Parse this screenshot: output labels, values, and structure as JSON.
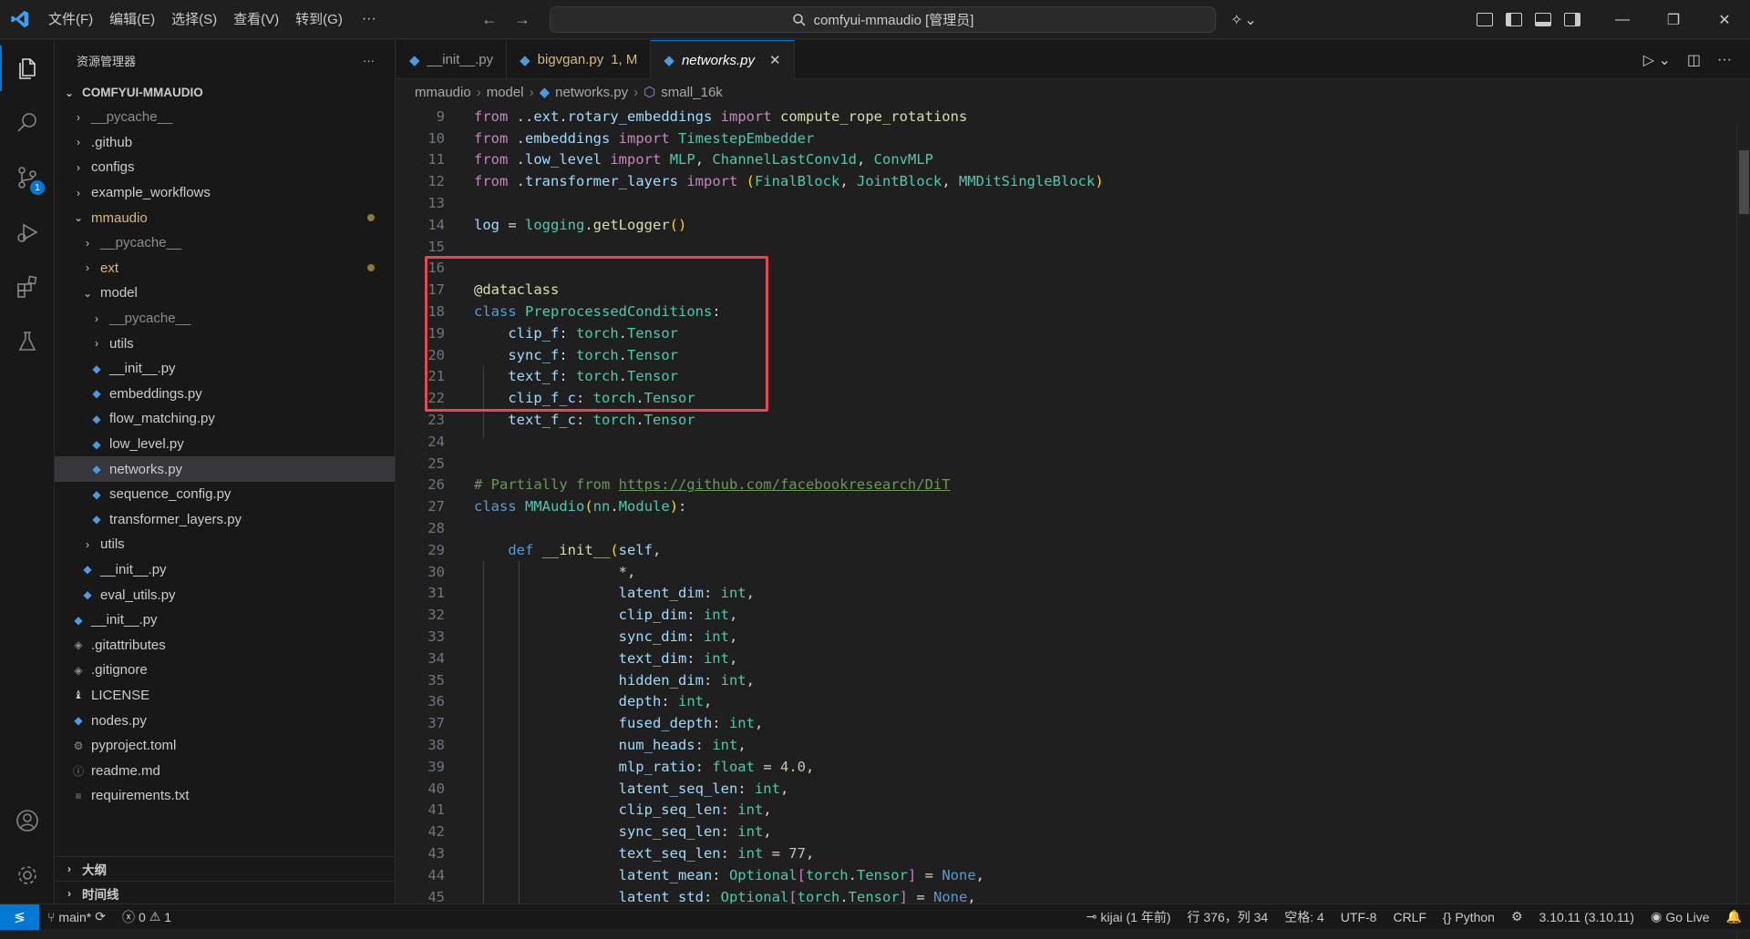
{
  "titlebar": {
    "menus": [
      "文件(F)",
      "编辑(E)",
      "选择(S)",
      "查看(V)",
      "转到(G)"
    ],
    "search_text": "comfyui-mmaudio [管理员]"
  },
  "activity": {
    "scm_badge": "1"
  },
  "sidebar": {
    "header": "资源管理器",
    "root": "COMFYUI-MMAUDIO",
    "items": [
      {
        "label": "__pycache__",
        "depth": 1,
        "kind": "folder",
        "open": false,
        "dim": true
      },
      {
        "label": ".github",
        "depth": 1,
        "kind": "folder",
        "open": false
      },
      {
        "label": "configs",
        "depth": 1,
        "kind": "folder",
        "open": false
      },
      {
        "label": "example_workflows",
        "depth": 1,
        "kind": "folder",
        "open": false
      },
      {
        "label": "mmaudio",
        "depth": 1,
        "kind": "folder",
        "open": true,
        "modified": true
      },
      {
        "label": "__pycache__",
        "depth": 2,
        "kind": "folder",
        "open": false,
        "dim": true
      },
      {
        "label": "ext",
        "depth": 2,
        "kind": "folder",
        "open": false,
        "modified": true
      },
      {
        "label": "model",
        "depth": 2,
        "kind": "folder",
        "open": true
      },
      {
        "label": "__pycache__",
        "depth": 3,
        "kind": "folder",
        "open": false,
        "dim": true
      },
      {
        "label": "utils",
        "depth": 3,
        "kind": "folder",
        "open": false
      },
      {
        "label": "__init__.py",
        "depth": 3,
        "kind": "py"
      },
      {
        "label": "embeddings.py",
        "depth": 3,
        "kind": "py"
      },
      {
        "label": "flow_matching.py",
        "depth": 3,
        "kind": "py"
      },
      {
        "label": "low_level.py",
        "depth": 3,
        "kind": "py"
      },
      {
        "label": "networks.py",
        "depth": 3,
        "kind": "py",
        "selected": true
      },
      {
        "label": "sequence_config.py",
        "depth": 3,
        "kind": "py"
      },
      {
        "label": "transformer_layers.py",
        "depth": 3,
        "kind": "py"
      },
      {
        "label": "utils",
        "depth": 2,
        "kind": "folder",
        "open": false
      },
      {
        "label": "__init__.py",
        "depth": 2,
        "kind": "py"
      },
      {
        "label": "eval_utils.py",
        "depth": 2,
        "kind": "py"
      },
      {
        "label": "__init__.py",
        "depth": 1,
        "kind": "py"
      },
      {
        "label": ".gitattributes",
        "depth": 1,
        "kind": "git"
      },
      {
        "label": ".gitignore",
        "depth": 1,
        "kind": "git"
      },
      {
        "label": "LICENSE",
        "depth": 1,
        "kind": "license"
      },
      {
        "label": "nodes.py",
        "depth": 1,
        "kind": "py"
      },
      {
        "label": "pyproject.toml",
        "depth": 1,
        "kind": "toml"
      },
      {
        "label": "readme.md",
        "depth": 1,
        "kind": "info"
      },
      {
        "label": "requirements.txt",
        "depth": 1,
        "kind": "txt"
      }
    ],
    "outline_label": "大纲",
    "timeline_label": "时间线"
  },
  "tabs": [
    {
      "label": "__init__.py",
      "status": "",
      "active": false
    },
    {
      "label": "bigvgan.py",
      "status": "1, M",
      "active": false
    },
    {
      "label": "networks.py",
      "status": "",
      "active": true
    }
  ],
  "breadcrumb": [
    "mmaudio",
    "model",
    "networks.py",
    "small_16k"
  ],
  "code_lines": [
    {
      "n": "9",
      "html": "<span class='kw2'>from</span><span class='pl'> ..</span><span class='var'>ext</span><span class='pl'>.</span><span class='var'>rotary_embeddings</span><span class='pl'> </span><span class='kw2'>import</span><span class='pl'> </span><span class='fn'>compute_rope_rotations</span>"
    },
    {
      "n": "10",
      "html": "<span class='kw2'>from</span><span class='pl'> .</span><span class='var'>embeddings</span><span class='pl'> </span><span class='kw2'>import</span><span class='pl'> </span><span class='cls'>TimestepEmbedder</span>"
    },
    {
      "n": "11",
      "html": "<span class='kw2'>from</span><span class='pl'> .</span><span class='var'>low_level</span><span class='pl'> </span><span class='kw2'>import</span><span class='pl'> </span><span class='cls'>MLP</span><span class='pl'>, </span><span class='cls'>ChannelLastConv1d</span><span class='pl'>, </span><span class='cls'>ConvMLP</span>"
    },
    {
      "n": "12",
      "html": "<span class='kw2'>from</span><span class='pl'> .</span><span class='var'>transformer_layers</span><span class='pl'> </span><span class='kw2'>import</span><span class='pl'> </span><span class='br'>(</span><span class='cls'>FinalBlock</span><span class='pl'>, </span><span class='cls'>JointBlock</span><span class='pl'>, </span><span class='cls'>MMDitSingleBlock</span><span class='br'>)</span>"
    },
    {
      "n": "13",
      "html": ""
    },
    {
      "n": "14",
      "html": "<span class='var'>log</span><span class='pl'> = </span><span class='cls'>logging</span><span class='pl'>.</span><span class='fn'>getLogger</span><span class='br'>()</span>"
    },
    {
      "n": "15",
      "html": ""
    },
    {
      "n": "16",
      "html": ""
    },
    {
      "n": "17",
      "html": "<span class='dec'>@dataclass</span>"
    },
    {
      "n": "18",
      "html": "<span class='kw'>class</span><span class='pl'> </span><span class='cls'>PreprocessedConditions</span><span class='pl'>:</span>"
    },
    {
      "n": "19",
      "html": "<span class='pl'>    </span><span class='var'>clip_f</span><span class='pl'>: </span><span class='cls'>torch</span><span class='pl'>.</span><span class='cls'>Tensor</span>"
    },
    {
      "n": "20",
      "html": "<span class='pl'>    </span><span class='var'>sync_f</span><span class='pl'>: </span><span class='cls'>torch</span><span class='pl'>.</span><span class='cls'>Tensor</span>"
    },
    {
      "n": "21",
      "html": "<span class='pl'>    </span><span class='var'>text_f</span><span class='pl'>: </span><span class='cls'>torch</span><span class='pl'>.</span><span class='cls'>Tensor</span>"
    },
    {
      "n": "22",
      "html": "<span class='pl'>    </span><span class='var'>clip_f_c</span><span class='pl'>: </span><span class='cls'>torch</span><span class='pl'>.</span><span class='cls'>Tensor</span>"
    },
    {
      "n": "23",
      "html": "<span class='pl'>    </span><span class='var'>text_f_c</span><span class='pl'>: </span><span class='cls'>torch</span><span class='pl'>.</span><span class='cls'>Tensor</span>"
    },
    {
      "n": "24",
      "html": ""
    },
    {
      "n": "25",
      "html": ""
    },
    {
      "n": "26",
      "html": "<span class='cm'># Partially from </span><span class='link'>https://github.com/facebookresearch/DiT</span>"
    },
    {
      "n": "27",
      "html": "<span class='kw'>class</span><span class='pl'> </span><span class='cls'>MMAudio</span><span class='br'>(</span><span class='cls'>nn</span><span class='pl'>.</span><span class='cls'>Module</span><span class='br'>)</span><span class='pl'>:</span>"
    },
    {
      "n": "28",
      "html": ""
    },
    {
      "n": "29",
      "html": "<span class='pl'>    </span><span class='kw'>def</span><span class='pl'> </span><span class='fn'>__init__</span><span class='br'>(</span><span class='var'>self</span><span class='pl'>,</span>"
    },
    {
      "n": "30",
      "html": "<span class='pl'>                 *,</span>"
    },
    {
      "n": "31",
      "html": "<span class='pl'>                 </span><span class='var'>latent_dim</span><span class='pl'>: </span><span class='cls'>int</span><span class='pl'>,</span>"
    },
    {
      "n": "32",
      "html": "<span class='pl'>                 </span><span class='var'>clip_dim</span><span class='pl'>: </span><span class='cls'>int</span><span class='pl'>,</span>"
    },
    {
      "n": "33",
      "html": "<span class='pl'>                 </span><span class='var'>sync_dim</span><span class='pl'>: </span><span class='cls'>int</span><span class='pl'>,</span>"
    },
    {
      "n": "34",
      "html": "<span class='pl'>                 </span><span class='var'>text_dim</span><span class='pl'>: </span><span class='cls'>int</span><span class='pl'>,</span>"
    },
    {
      "n": "35",
      "html": "<span class='pl'>                 </span><span class='var'>hidden_dim</span><span class='pl'>: </span><span class='cls'>int</span><span class='pl'>,</span>"
    },
    {
      "n": "36",
      "html": "<span class='pl'>                 </span><span class='var'>depth</span><span class='pl'>: </span><span class='cls'>int</span><span class='pl'>,</span>"
    },
    {
      "n": "37",
      "html": "<span class='pl'>                 </span><span class='var'>fused_depth</span><span class='pl'>: </span><span class='cls'>int</span><span class='pl'>,</span>"
    },
    {
      "n": "38",
      "html": "<span class='pl'>                 </span><span class='var'>num_heads</span><span class='pl'>: </span><span class='cls'>int</span><span class='pl'>,</span>"
    },
    {
      "n": "39",
      "html": "<span class='pl'>                 </span><span class='var'>mlp_ratio</span><span class='pl'>: </span><span class='cls'>float</span><span class='pl'> = </span><span class='num'>4.0</span><span class='pl'>,</span>"
    },
    {
      "n": "40",
      "html": "<span class='pl'>                 </span><span class='var'>latent_seq_len</span><span class='pl'>: </span><span class='cls'>int</span><span class='pl'>,</span>"
    },
    {
      "n": "41",
      "html": "<span class='pl'>                 </span><span class='var'>clip_seq_len</span><span class='pl'>: </span><span class='cls'>int</span><span class='pl'>,</span>"
    },
    {
      "n": "42",
      "html": "<span class='pl'>                 </span><span class='var'>sync_seq_len</span><span class='pl'>: </span><span class='cls'>int</span><span class='pl'>,</span>"
    },
    {
      "n": "43",
      "html": "<span class='pl'>                 </span><span class='var'>text_seq_len</span><span class='pl'>: </span><span class='cls'>int</span><span class='pl'> = </span><span class='num'>77</span><span class='pl'>,</span>"
    },
    {
      "n": "44",
      "html": "<span class='pl'>                 </span><span class='var'>latent_mean</span><span class='pl'>: </span><span class='cls'>Optional</span><span class='br2'>[</span><span class='cls'>torch</span><span class='pl'>.</span><span class='cls'>Tensor</span><span class='br2'>]</span><span class='pl'> = </span><span class='kw'>None</span><span class='pl'>,</span>"
    },
    {
      "n": "45",
      "html": "<span class='pl'>                 </span><span class='var'>latent_std</span><span class='pl'>: </span><span class='cls'>Optional</span><span class='br2'>[</span><span class='cls'>torch</span><span class='pl'>.</span><span class='cls'>Tensor</span><span class='br2'>]</span><span class='pl'> = </span><span class='kw'>None</span><span class='pl'>,</span>"
    }
  ],
  "statusbar": {
    "branch": "main*",
    "errors": "0",
    "warnings": "1",
    "blame": "kijai (1 年前)",
    "position": "行 376，列 34",
    "spaces": "空格: 4",
    "encoding": "UTF-8",
    "eol": "CRLF",
    "language": "Python",
    "interpreter": "3.10.11 (3.10.11)",
    "golive": "Go Live"
  },
  "colors": {
    "accent": "#0078d4",
    "highlight_box": "#e5484d",
    "modified": "#d7ba7d"
  }
}
